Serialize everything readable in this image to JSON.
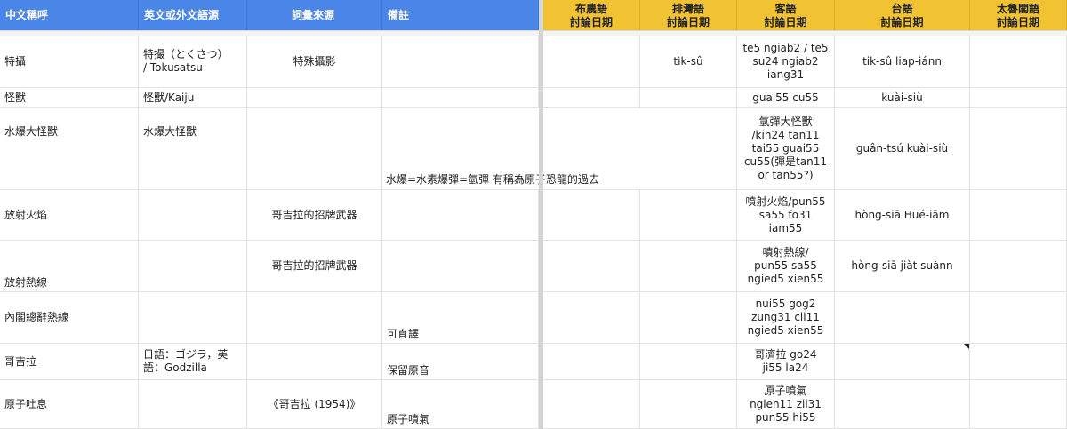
{
  "headers": {
    "zh": "中文稱呼",
    "en": "英文或外文語源",
    "src": "詞彙來源",
    "note": "備註",
    "bunun": "布農語\n討論日期",
    "paiwan": "排灣語\n討論日期",
    "hakka": "客語\n討論日期",
    "taigi": "台語\n討論日期",
    "taroko": "太魯閣語\n討論日期"
  },
  "rows": [
    {
      "zh": "特攝",
      "en": "特撮（とくさつ）\n/ Tokusatsu",
      "src": "特殊攝影",
      "note": "",
      "paiwan": "tìk-sû",
      "hakka": "te5 ngiab2 / te5\nsu24 ngiab2\niang31",
      "taigi": "tik-sû liap-iánn"
    },
    {
      "zh": "怪獸",
      "en": "怪獸/Kaiju",
      "src": "",
      "note": "",
      "paiwan": "",
      "hakka": "guai55 cu55",
      "taigi": "kuài-siù"
    },
    {
      "zh": "水爆大怪獸",
      "en": "水爆大怪獸",
      "src": "",
      "note": "水爆=水素爆彈=氫彈  有稱為原子恐龍的過去",
      "paiwan": "",
      "hakka": "氫彈大怪獸\n/kin24 tan11\ntai55 guai55\ncu55(彈是tan11\nor tan55?)",
      "taigi": "guân-tsú kuài-siù"
    },
    {
      "zh": "放射火焰",
      "en": "",
      "src": "哥吉拉的招牌武器",
      "note": "",
      "paiwan": "",
      "hakka": "噴射火焰/pun55\nsa55 fo31\niam55",
      "taigi": "hòng-siā Hué-iām"
    },
    {
      "zh": "放射熱線",
      "en": "",
      "src": "哥吉拉的招牌武器",
      "note": "",
      "paiwan": "",
      "hakka": "噴射熱線/\npun55 sa55\nngied5 xien55",
      "taigi": "hòng-siā jiàt suànn"
    },
    {
      "zh": "內閣總辭熱線",
      "en": "",
      "src": "",
      "note": "可直譯",
      "paiwan": "",
      "hakka": "nui55 gog2\nzung31 cii11\nngied5 xien55",
      "taigi": ""
    },
    {
      "zh": "哥吉拉",
      "en": "日語：ゴジラ，英\n語：Godzilla",
      "src": "",
      "note": "保留原音",
      "paiwan": "",
      "hakka": "哥濟拉 go24\nji55 la24",
      "taigi": ""
    },
    {
      "zh": "原子吐息",
      "en": "",
      "src": "《哥吉拉 (1954)》",
      "note": "原子噴氣",
      "paiwan": "",
      "hakka": "原子噴氣\nngien11 zii31\npun55 hi55",
      "taigi": ""
    }
  ]
}
